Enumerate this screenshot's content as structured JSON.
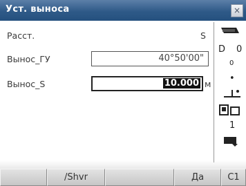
{
  "window": {
    "title": "Уст. выноса",
    "close_glyph": "×"
  },
  "fields": {
    "distance": {
      "label": "Расст.",
      "mode": "S"
    },
    "angle": {
      "label": "Вынос_ГУ",
      "value": "40°50'00\""
    },
    "dist_input": {
      "label": "Вынос_S",
      "value": "10.000",
      "unit": "м"
    }
  },
  "status_panel": {
    "battery": "icon-battery",
    "tilt_top": "0",
    "tilt_left": "D",
    "prism_const": "0",
    "target": "1",
    "page": "1"
  },
  "softkeys": [
    "",
    "/Shvr",
    "",
    "Да",
    "C1"
  ],
  "colors": {
    "titlebar": "#2f5a88",
    "softbar": "#d4d4d4"
  }
}
